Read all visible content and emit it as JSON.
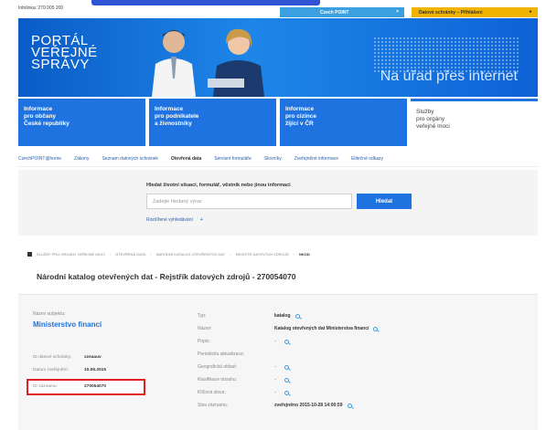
{
  "topbar": {
    "phone": "Infolinka: 270 005 200",
    "czechpoint": "Czech POINT",
    "czechpoint_close": "×",
    "datovky": "Datové schránky – Přihlášení",
    "datovky_arrow": "►"
  },
  "banner": {
    "logo_line1": "PORTÁL",
    "logo_line2": "VEŘEJNÉ",
    "logo_line3": "SPRÁVY",
    "tagline": "Na úřad přes internet"
  },
  "tiles": [
    {
      "l1": "Informace",
      "l2": "pro občany",
      "l3": "České republiky"
    },
    {
      "l1": "Informace",
      "l2": "pro podnikatele",
      "l3": "a živnostníky"
    },
    {
      "l1": "Informace",
      "l2": "pro cizince",
      "l3": "žijící v ČR"
    },
    {
      "l1": "Služby",
      "l2": "pro orgány",
      "l3": "veřejné moci"
    }
  ],
  "nav": [
    "CzechPOINT@home",
    "Zákony",
    "Seznam datových schránek",
    "Otevřená data",
    "Servisní formuláře",
    "Slovníky",
    "Zveřejněné informace",
    "Elitečné odkazy"
  ],
  "search": {
    "title": "Hledat životní situaci, formulář, věstník nebo jinou informaci",
    "placeholder": "Zadejte hledaný výraz",
    "button": "Hledat",
    "advanced": "Rozšířené vyhledávání",
    "advanced_plus": "+"
  },
  "breadcrumb": [
    "Služby pro orgány veřejné moci",
    "Otevřená data",
    "Národní katalog otevřených dat",
    "Registr datových zdrojů",
    "NKOD"
  ],
  "page_title": "Národní katalog otevřených dat - Rejstřík datových zdrojů - 270054070",
  "detail": {
    "subject_label": "Název subjektu:",
    "subject_name": "Ministerstvo financí",
    "ds_label": "ID datové schránky:",
    "ds_value": "xzeaauv",
    "date_label": "Datum zveřejnění:",
    "date_value": "10.06.2015",
    "id_label": "ID záznamu:",
    "id_value": "270054070",
    "rows": [
      {
        "k": "Typ:",
        "v": "katalog",
        "mag": true,
        "dash": false
      },
      {
        "k": "Název:",
        "v": "Katalog otevřených dat Ministerstva financí",
        "mag": true,
        "dash": false
      },
      {
        "k": "Popis:",
        "v": "",
        "mag": true,
        "dash": true
      },
      {
        "k": "Periodicita aktualizace:",
        "v": "",
        "mag": false,
        "dash": false
      },
      {
        "k": "Geografická oblast:",
        "v": "",
        "mag": true,
        "dash": true
      },
      {
        "k": "Klasifikace obsahu:",
        "v": "",
        "mag": true,
        "dash": true
      },
      {
        "k": "Klíčová slova:",
        "v": "",
        "mag": true,
        "dash": true
      },
      {
        "k": "Stav záznamu:",
        "v": "zveřejněno 2015-10-28 14:00:59",
        "mag": true,
        "dash": false
      }
    ]
  }
}
